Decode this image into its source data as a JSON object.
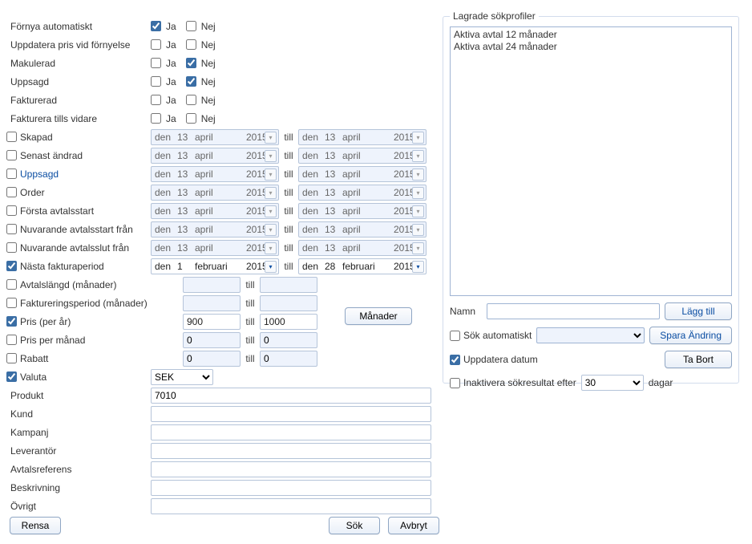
{
  "filters": {
    "auto_renew": {
      "label": "Förnya automatiskt",
      "yes": "Ja",
      "no": "Nej",
      "yes_checked": true,
      "no_checked": false
    },
    "update_price": {
      "label": "Uppdatera pris vid förnyelse",
      "yes": "Ja",
      "no": "Nej",
      "yes_checked": false,
      "no_checked": false
    },
    "cancelled": {
      "label": "Makulerad",
      "yes": "Ja",
      "no": "Nej",
      "yes_checked": false,
      "no_checked": true
    },
    "terminated": {
      "label": "Uppsagd",
      "yes": "Ja",
      "no": "Nej",
      "yes_checked": false,
      "no_checked": true
    },
    "invoiced": {
      "label": "Fakturerad",
      "yes": "Ja",
      "no": "Nej",
      "yes_checked": false,
      "no_checked": false
    },
    "invoice_until": {
      "label": "Fakturera tills vidare",
      "yes": "Ja",
      "no": "Nej",
      "yes_checked": false,
      "no_checked": false
    }
  },
  "date_rows": [
    {
      "id": "created",
      "label": "Skapad",
      "checked": false,
      "from": {
        "den": "den",
        "d": "13",
        "m": "april",
        "y": "2015"
      },
      "to": {
        "den": "den",
        "d": "13",
        "m": "april",
        "y": "2015"
      }
    },
    {
      "id": "modified",
      "label": "Senast ändrad",
      "checked": false,
      "from": {
        "den": "den",
        "d": "13",
        "m": "april",
        "y": "2015"
      },
      "to": {
        "den": "den",
        "d": "13",
        "m": "april",
        "y": "2015"
      }
    },
    {
      "id": "terminated_date",
      "label": "Uppsagd",
      "checked": false,
      "blue": true,
      "from": {
        "den": "den",
        "d": "13",
        "m": "april",
        "y": "2015"
      },
      "to": {
        "den": "den",
        "d": "13",
        "m": "april",
        "y": "2015"
      }
    },
    {
      "id": "order",
      "label": "Order",
      "checked": false,
      "from": {
        "den": "den",
        "d": "13",
        "m": "april",
        "y": "2015"
      },
      "to": {
        "den": "den",
        "d": "13",
        "m": "april",
        "y": "2015"
      }
    },
    {
      "id": "first_start",
      "label": "Första avtalsstart",
      "checked": false,
      "from": {
        "den": "den",
        "d": "13",
        "m": "april",
        "y": "2015"
      },
      "to": {
        "den": "den",
        "d": "13",
        "m": "april",
        "y": "2015"
      }
    },
    {
      "id": "cur_start",
      "label": "Nuvarande avtalsstart från",
      "checked": false,
      "from": {
        "den": "den",
        "d": "13",
        "m": "april",
        "y": "2015"
      },
      "to": {
        "den": "den",
        "d": "13",
        "m": "april",
        "y": "2015"
      }
    },
    {
      "id": "cur_end",
      "label": "Nuvarande avtalsslut från",
      "checked": false,
      "from": {
        "den": "den",
        "d": "13",
        "m": "april",
        "y": "2015"
      },
      "to": {
        "den": "den",
        "d": "13",
        "m": "april",
        "y": "2015"
      }
    },
    {
      "id": "next_inv",
      "label": "Nästa fakturaperiod",
      "checked": true,
      "active": true,
      "from": {
        "den": "den",
        "d": "1",
        "m": "februari",
        "y": "2015"
      },
      "to": {
        "den": "den",
        "d": "28",
        "m": "februari",
        "y": "2015"
      }
    }
  ],
  "till": "till",
  "num_rows": {
    "avtalslangd": {
      "label": "Avtalslängd (månader)",
      "checked": false,
      "from": "",
      "to": ""
    },
    "faktperiod": {
      "label": "Faktureringsperiod (månader)",
      "checked": false,
      "from": "",
      "to": ""
    },
    "pris_ar": {
      "label": "Pris (per år)",
      "checked": true,
      "from": "900",
      "to": "1000",
      "active": true
    },
    "pris_man": {
      "label": "Pris per månad",
      "checked": false,
      "from": "0",
      "to": "0"
    },
    "rabatt": {
      "label": "Rabatt",
      "checked": false,
      "from": "0",
      "to": "0"
    }
  },
  "months_button": "Månader",
  "valuta": {
    "label": "Valuta",
    "checked": true,
    "value": "SEK"
  },
  "text_rows": {
    "produkt": {
      "label": "Produkt",
      "value": "7010"
    },
    "kund": {
      "label": "Kund",
      "value": ""
    },
    "kampanj": {
      "label": "Kampanj",
      "value": ""
    },
    "leverantor": {
      "label": "Leverantör",
      "value": ""
    },
    "avtalsref": {
      "label": "Avtalsreferens",
      "value": ""
    },
    "beskrivning": {
      "label": "Beskrivning",
      "value": ""
    },
    "ovrigt": {
      "label": "Övrigt",
      "value": ""
    }
  },
  "buttons": {
    "rensa": "Rensa",
    "sok": "Sök",
    "avbryt": "Avbryt"
  },
  "profiles": {
    "legend": "Lagrade sökprofiler",
    "items": [
      "Aktiva avtal 12 månader",
      "Aktiva avtal 24 månader"
    ],
    "namn_label": "Namn",
    "namn_value": "",
    "sok_auto": {
      "label": "Sök automatiskt",
      "checked": false
    },
    "uppdatera": {
      "label": "Uppdatera datum",
      "checked": true
    },
    "inaktivera": {
      "label": "Inaktivera sökresultat efter",
      "checked": false,
      "value": "30",
      "suffix": "dagar"
    },
    "lagg_till": "Lägg till",
    "spara": "Spara Ändring",
    "tabort": "Ta Bort"
  }
}
